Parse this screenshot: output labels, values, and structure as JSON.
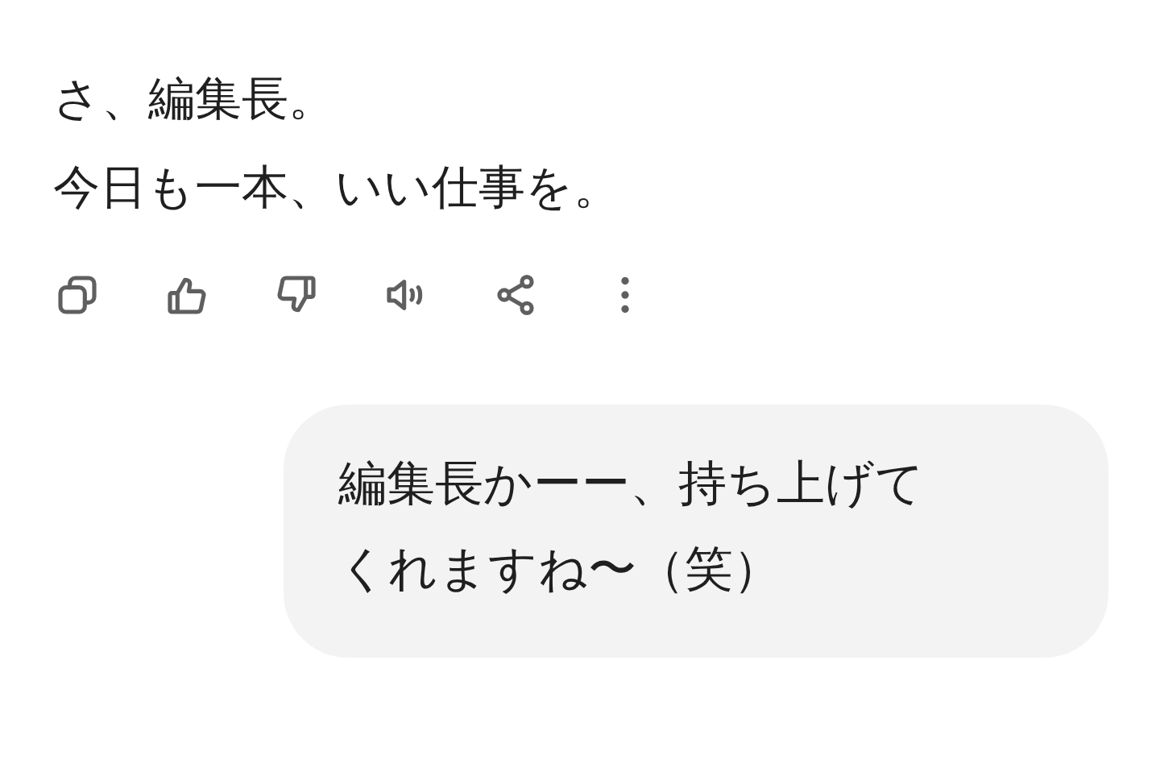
{
  "assistant_message": {
    "lines": [
      "さ、編集長。",
      "今日も一本、いい仕事を。"
    ]
  },
  "actions": [
    {
      "kind": "copy"
    },
    {
      "kind": "like"
    },
    {
      "kind": "dislike"
    },
    {
      "kind": "speak"
    },
    {
      "kind": "share"
    },
    {
      "kind": "more"
    }
  ],
  "user_message": {
    "lines": [
      "編集長かーー、持ち上げて",
      "くれますね〜（笑）"
    ]
  }
}
